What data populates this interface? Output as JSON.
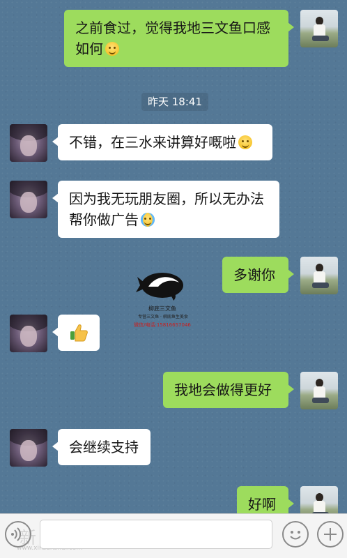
{
  "messages": [
    {
      "sender": "self",
      "text": "之前食过，觉得我地三文鱼口感如何",
      "emoji": "smiling-face"
    },
    {
      "sender": "other",
      "text": "不错，在三水来讲算好嘅啦",
      "emoji": "smiling-face"
    },
    {
      "sender": "other",
      "text": "因为我无玩朋友圈，所以无办法帮你做广告",
      "emoji": "crying-face"
    },
    {
      "sender": "self",
      "text": "多谢你"
    },
    {
      "sender": "other",
      "text": "",
      "emoji": "thumbs-up"
    },
    {
      "sender": "self",
      "text": "我地会做得更好"
    },
    {
      "sender": "other",
      "text": "会继续支持"
    },
    {
      "sender": "self",
      "text": "好啊"
    }
  ],
  "timestamp": "昨天 18:41",
  "watermark": {
    "caption": "柳底三文鱼",
    "subcaption": "专营三文鱼 · 柳底鱼生美食",
    "phone": "微信/电话:15816657046"
  },
  "input_bar": {
    "voice_icon": "voice-icon",
    "placeholder": "",
    "emoji_icon": "emoji-icon",
    "plus_icon": "plus-icon",
    "site_watermark": "新三水",
    "site_url": "www.xinsanshui.com"
  },
  "colors": {
    "background": "#547896",
    "my_bubble": "#9ddc5d",
    "their_bubble": "#ffffff",
    "timestamp_text": "#ffffff"
  }
}
